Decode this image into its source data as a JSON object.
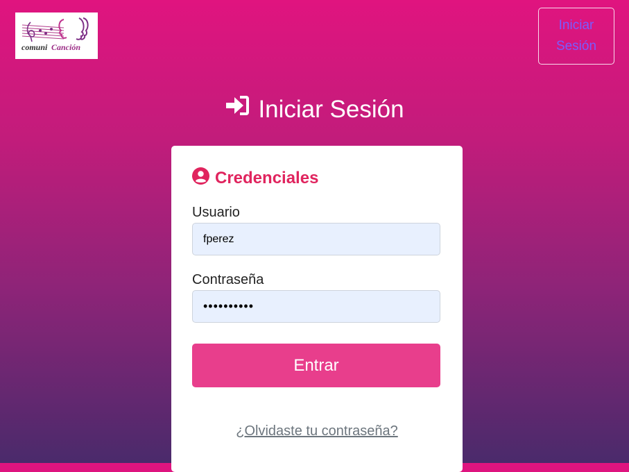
{
  "header": {
    "logo_text_1": "comuni",
    "logo_text_2": "Canción",
    "nav_button": "Iniciar Sesión"
  },
  "page": {
    "title": "Iniciar Sesión",
    "title_icon": "sign-in-icon"
  },
  "form": {
    "section_title": "Credenciales",
    "section_icon": "user-circle-icon",
    "username_label": "Usuario",
    "username_value": "fperez",
    "password_label": "Contraseña",
    "password_value": "••••••••••",
    "submit_label": "Entrar",
    "forgot_link": "¿Olvidaste tu contraseña?"
  },
  "colors": {
    "gradient_top": "#e0147f",
    "gradient_bottom": "#4a2a6b",
    "accent": "#e0245e",
    "button": "#e83e8c",
    "nav_text": "#7a5cff"
  }
}
